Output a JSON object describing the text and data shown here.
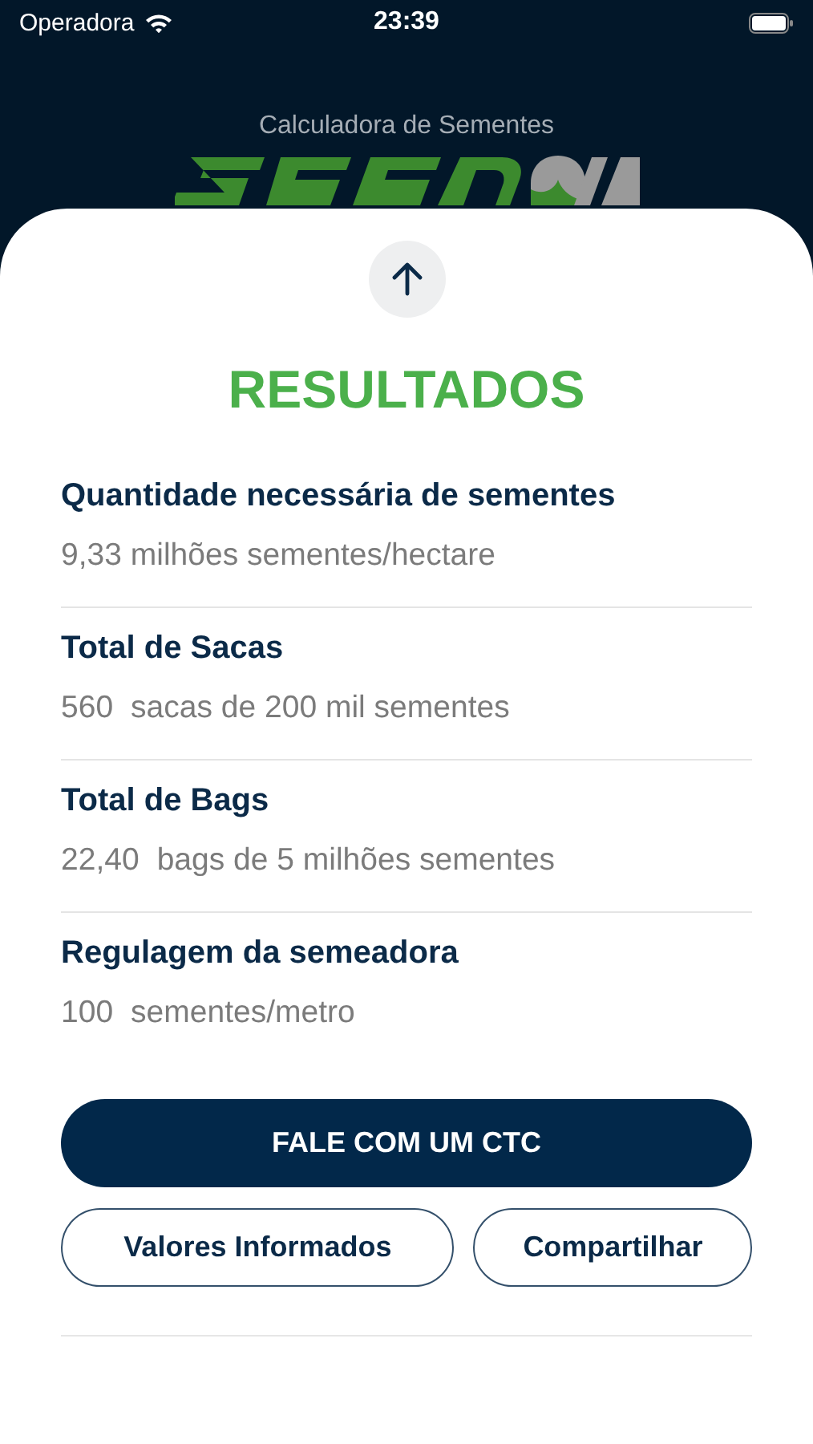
{
  "status_bar": {
    "carrier": "Operadora",
    "time": "23:39"
  },
  "header": {
    "subtitle": "Calculadora de Sementes"
  },
  "title": "RESULTADOS",
  "results": [
    {
      "label": "Quantidade necessária de sementes",
      "value": "9,33 milhões sementes/hectare"
    },
    {
      "label": "Total de Sacas",
      "value": "560",
      "unit": "sacas de 200 mil sementes"
    },
    {
      "label": "Total de Bags",
      "value": "22,40",
      "unit": "bags de 5 milhões sementes"
    },
    {
      "label": "Regulagem da semeadora",
      "value": "100",
      "unit": "sementes/metro"
    }
  ],
  "primary_button": "FALE COM UM CTC",
  "secondary_buttons": [
    "Valores Informados",
    "Compartilhar"
  ]
}
